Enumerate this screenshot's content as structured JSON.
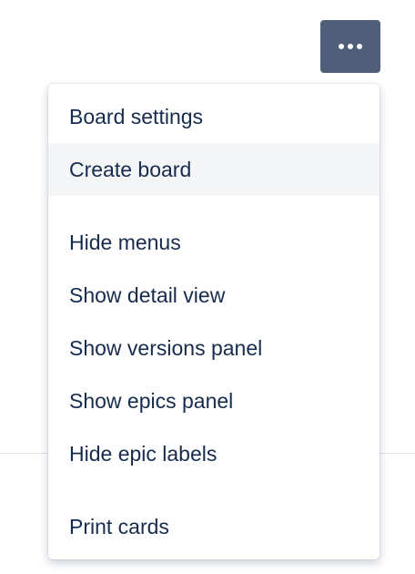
{
  "more_button": {
    "icon": "more-horizontal-icon",
    "background_color": "#505f79"
  },
  "menu": {
    "groups": [
      {
        "items": [
          {
            "label": "Board settings"
          },
          {
            "label": "Create board",
            "highlighted": true
          }
        ]
      },
      {
        "items": [
          {
            "label": "Hide menus"
          },
          {
            "label": "Show detail view"
          },
          {
            "label": "Show versions panel"
          },
          {
            "label": "Show epics panel"
          },
          {
            "label": "Hide epic labels"
          }
        ]
      },
      {
        "items": [
          {
            "label": "Print cards"
          }
        ]
      }
    ]
  },
  "colors": {
    "text": "#172b4d",
    "hover_background": "#f4f5f7"
  }
}
